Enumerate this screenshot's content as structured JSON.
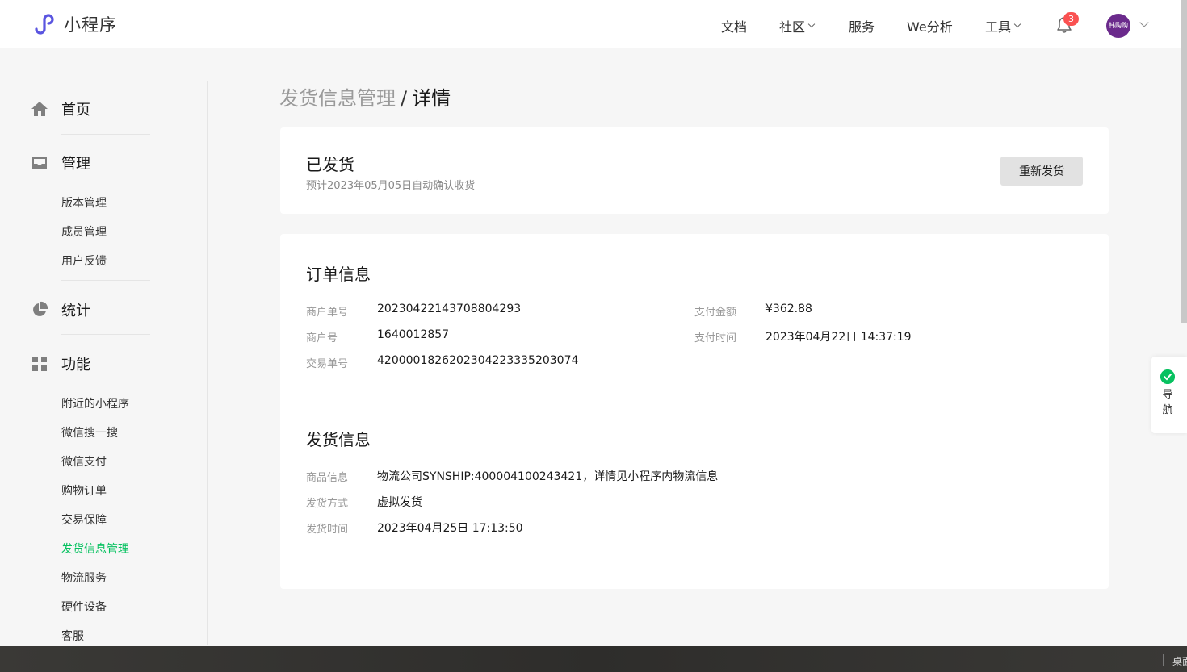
{
  "header": {
    "logo_text": "小程序",
    "nav": {
      "docs": "文档",
      "community": "社区",
      "service": "服务",
      "analytics": "We分析",
      "tools": "工具"
    },
    "notification_count": "3",
    "avatar_text": "韩购购"
  },
  "sidebar": {
    "home": "首页",
    "manage": "管理",
    "manage_items": [
      "版本管理",
      "成员管理",
      "用户反馈"
    ],
    "stats": "统计",
    "features": "功能",
    "feature_items": [
      "附近的小程序",
      "微信搜一搜",
      "微信支付",
      "购物订单",
      "交易保障",
      "发货信息管理",
      "物流服务",
      "硬件设备",
      "客服"
    ],
    "active_item": "发货信息管理"
  },
  "breadcrumb": {
    "parent": "发货信息管理",
    "separator": "/",
    "current": "详情"
  },
  "status": {
    "title": "已发货",
    "subtitle": "预计2023年05月05日自动确认收货",
    "reship_button": "重新发货"
  },
  "order": {
    "title": "订单信息",
    "merchant_order_no_label": "商户单号",
    "merchant_order_no": "20230422143708804293",
    "merchant_id_label": "商户号",
    "merchant_id": "1640012857",
    "transaction_no_label": "交易单号",
    "transaction_no": "4200001826202304223335203074",
    "pay_amount_label": "支付金额",
    "pay_amount": "¥362.88",
    "pay_time_label": "支付时间",
    "pay_time": "2023年04月22日 14:37:19"
  },
  "shipping": {
    "title": "发货信息",
    "goods_label": "商品信息",
    "goods": "物流公司SYNSHIP:400004100243421，详情见小程序内物流信息",
    "method_label": "发货方式",
    "method": "虚拟发货",
    "time_label": "发货时间",
    "time": "2023年04月25日 17:13:50"
  },
  "float_nav": {
    "label": "导航"
  },
  "taskbar": {
    "text": "桌面"
  },
  "colors": {
    "accent_green": "#07c160",
    "badge_red": "#fa5151",
    "logo_purple": "#5a55e0"
  }
}
